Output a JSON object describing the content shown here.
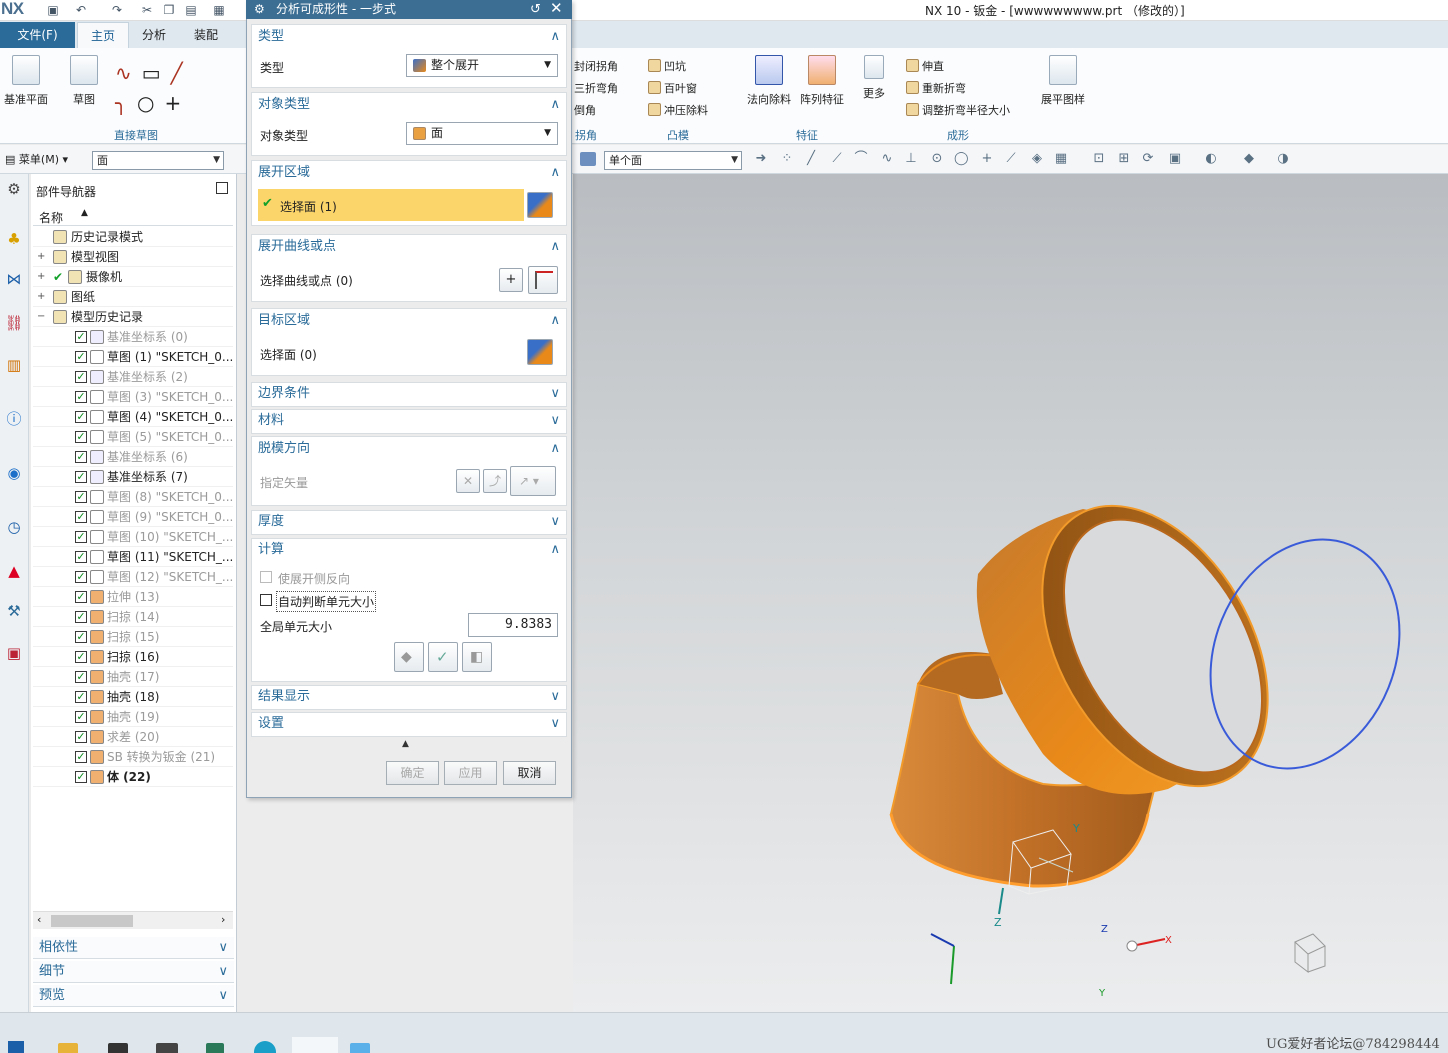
{
  "app": {
    "logo": "NX",
    "window_title": "NX 10 - 钣金 - [wwwwwwwww.prt （修改的）]"
  },
  "menu": {
    "file": "文件(F)",
    "tabs": [
      "主页",
      "分析",
      "装配"
    ],
    "active_tab": "主页"
  },
  "ribbon": {
    "datum_plane": "基准平面",
    "sketch": "草图",
    "direct_sketch_group": "直接草图",
    "closed_corner": "封闭拐角",
    "three_bend_corner": "三折弯角",
    "chamfer": "倒角",
    "corner_group": "拐角",
    "dimple": "凹坑",
    "louver": "百叶窗",
    "punch_remove": "冲压除料",
    "emboss_group": "凸模",
    "normal_cutout": "法向除料",
    "pattern_feature": "阵列特征",
    "more": "更多",
    "feature_group": "特征",
    "unbend": "伸直",
    "rebend": "重新折弯",
    "adjust_bend_radius": "调整折弯半径大小",
    "form_group": "成形",
    "flat_pattern": "展平图样"
  },
  "toolbar2": {
    "menu_label": "菜单(M)",
    "filter_value": "面",
    "face_rule": "单个面"
  },
  "navigator": {
    "title": "部件导航器",
    "column_name": "名称",
    "rows": [
      {
        "label": "历史记录模式",
        "level": 0,
        "dim": false,
        "checked": false,
        "exp": ""
      },
      {
        "label": "模型视图",
        "level": 0,
        "dim": false,
        "checked": false,
        "exp": "+"
      },
      {
        "label": "摄像机",
        "level": 0,
        "dim": false,
        "checked": true,
        "exp": "+"
      },
      {
        "label": "图纸",
        "level": 0,
        "dim": false,
        "checked": false,
        "exp": "+"
      },
      {
        "label": "模型历史记录",
        "level": 0,
        "dim": false,
        "checked": false,
        "exp": "−"
      },
      {
        "label": "基准坐标系 (0)",
        "level": 1,
        "dim": true,
        "checked": true
      },
      {
        "label": "草图 (1) \"SKETCH_0...",
        "level": 1,
        "dim": false,
        "checked": true
      },
      {
        "label": "基准坐标系 (2)",
        "level": 1,
        "dim": true,
        "checked": true
      },
      {
        "label": "草图 (3) \"SKETCH_0...",
        "level": 1,
        "dim": true,
        "checked": true
      },
      {
        "label": "草图 (4) \"SKETCH_0...",
        "level": 1,
        "dim": false,
        "checked": true
      },
      {
        "label": "草图 (5) \"SKETCH_0...",
        "level": 1,
        "dim": true,
        "checked": true
      },
      {
        "label": "基准坐标系 (6)",
        "level": 1,
        "dim": true,
        "checked": true
      },
      {
        "label": "基准坐标系 (7)",
        "level": 1,
        "dim": false,
        "checked": true
      },
      {
        "label": "草图 (8) \"SKETCH_0...",
        "level": 1,
        "dim": true,
        "checked": true
      },
      {
        "label": "草图 (9) \"SKETCH_0...",
        "level": 1,
        "dim": true,
        "checked": true
      },
      {
        "label": "草图 (10) \"SKETCH_...",
        "level": 1,
        "dim": true,
        "checked": true
      },
      {
        "label": "草图 (11) \"SKETCH_...",
        "level": 1,
        "dim": false,
        "checked": true
      },
      {
        "label": "草图 (12) \"SKETCH_...",
        "level": 1,
        "dim": true,
        "checked": true
      },
      {
        "label": "拉伸 (13)",
        "level": 1,
        "dim": true,
        "checked": true
      },
      {
        "label": "扫掠 (14)",
        "level": 1,
        "dim": true,
        "checked": true
      },
      {
        "label": "扫掠 (15)",
        "level": 1,
        "dim": true,
        "checked": true
      },
      {
        "label": "扫掠 (16)",
        "level": 1,
        "dim": false,
        "checked": true
      },
      {
        "label": "抽壳 (17)",
        "level": 1,
        "dim": true,
        "checked": true
      },
      {
        "label": "抽壳 (18)",
        "level": 1,
        "dim": false,
        "checked": true
      },
      {
        "label": "抽壳 (19)",
        "level": 1,
        "dim": true,
        "checked": true
      },
      {
        "label": "求差 (20)",
        "level": 1,
        "dim": true,
        "checked": true
      },
      {
        "label": "SB 转换为钣金 (21)",
        "level": 1,
        "dim": true,
        "checked": true
      },
      {
        "label": "体 (22)",
        "level": 1,
        "dim": false,
        "checked": true,
        "bold": true
      }
    ],
    "sections": [
      "相依性",
      "细节",
      "预览"
    ]
  },
  "dialog": {
    "title": "分析可成形性 - 一步式",
    "type_section": "类型",
    "type_label": "类型",
    "type_value": "整个展开",
    "object_type_section": "对象类型",
    "object_type_label": "对象类型",
    "object_type_value": "面",
    "unfold_region_section": "展开区域",
    "select_face": "选择面 (1)",
    "unfold_curve_section": "展开曲线或点",
    "select_curve": "选择曲线或点 (0)",
    "target_region_section": "目标区域",
    "select_face_target": "选择面 (0)",
    "boundary_section": "边界条件",
    "material_section": "材料",
    "draft_section": "脱模方向",
    "specify_vector": "指定矢量",
    "thickness_section": "厚度",
    "compute_section": "计算",
    "reverse_side": "使展开侧反向",
    "auto_element": "自动判断单元大小",
    "global_element": "全局单元大小",
    "global_element_value": "9.8383",
    "results_section": "结果显示",
    "settings_section": "设置",
    "ok": "确定",
    "apply": "应用",
    "cancel": "取消"
  },
  "viewport": {
    "axis_x": "X",
    "axis_y": "Y",
    "axis_z": "Z",
    "part_color": "#e8891a",
    "curve_color": "#3a5bd9"
  },
  "watermark": "UG爱好者论坛@784298444"
}
